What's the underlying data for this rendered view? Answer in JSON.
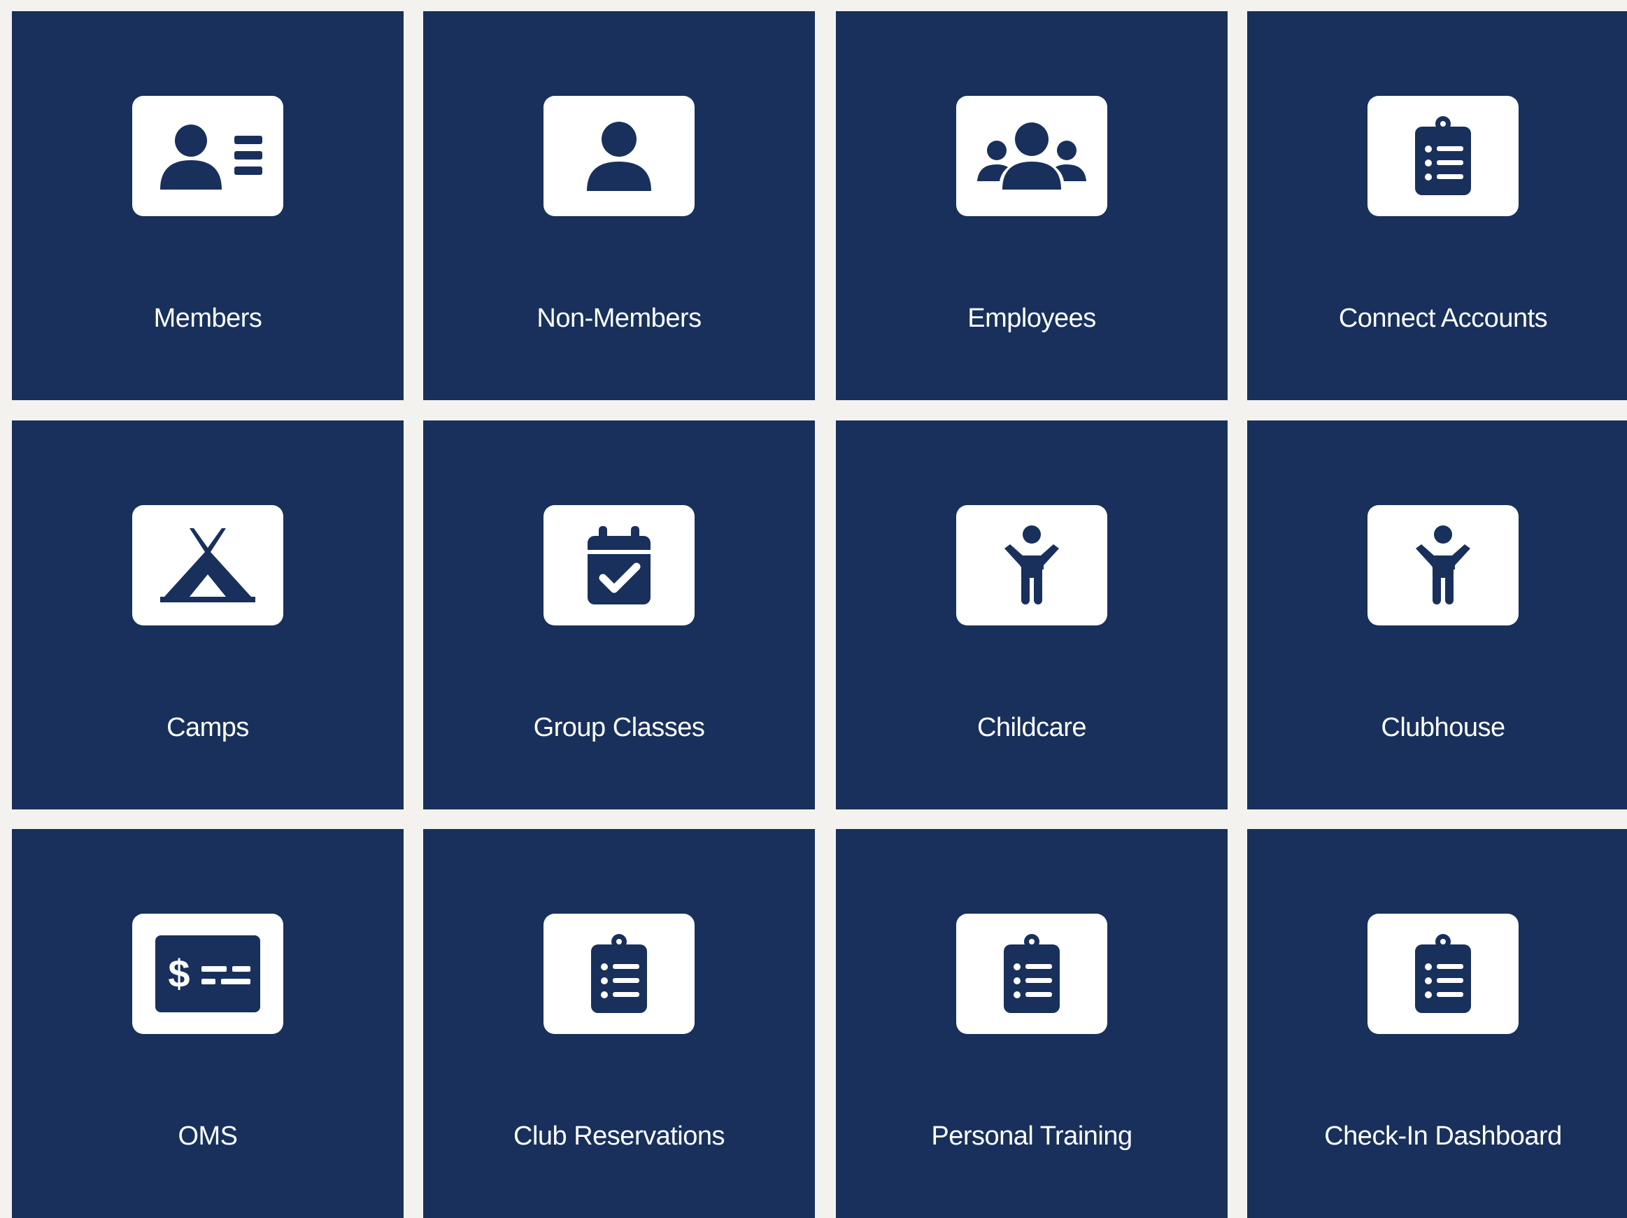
{
  "colors": {
    "background": "#f4f2ee",
    "tile": "#18305b",
    "icon_box": "#ffffff",
    "label": "#ffffff"
  },
  "tiles": [
    {
      "label": "Members",
      "icon": "id-card-icon"
    },
    {
      "label": "Non-Members",
      "icon": "user-icon"
    },
    {
      "label": "Employees",
      "icon": "users-group-icon"
    },
    {
      "label": "Connect Accounts",
      "icon": "clipboard-list-icon"
    },
    {
      "label": "Camps",
      "icon": "tent-icon"
    },
    {
      "label": "Group Classes",
      "icon": "calendar-check-icon"
    },
    {
      "label": "Childcare",
      "icon": "child-icon"
    },
    {
      "label": "Clubhouse",
      "icon": "child-icon"
    },
    {
      "label": "OMS",
      "icon": "money-check-icon"
    },
    {
      "label": "Club Reservations",
      "icon": "clipboard-list-icon"
    },
    {
      "label": "Personal Training",
      "icon": "clipboard-list-icon"
    },
    {
      "label": "Check-In Dashboard",
      "icon": "clipboard-list-icon"
    }
  ]
}
